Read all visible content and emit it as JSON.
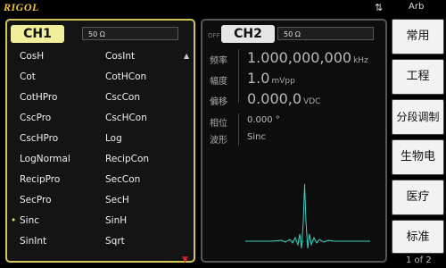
{
  "topbar": {
    "brand": "RIGOL",
    "usb_icon": "usb-icon",
    "mode": "Arb"
  },
  "ch1": {
    "badge": "CH1",
    "state": "OFF",
    "impedance": "50 Ω",
    "list_left": [
      "CosH",
      "Cot",
      "CotHPro",
      "CscPro",
      "CscHPro",
      "LogNormal",
      "RecipPro",
      "SecPro",
      "Sinc",
      "SinInt"
    ],
    "list_right": [
      "CosInt",
      "CotHCon",
      "CscCon",
      "CscHCon",
      "Log",
      "RecipCon",
      "SecCon",
      "SecH",
      "SinH",
      "Sqrt"
    ],
    "selected": "Sinc"
  },
  "ch2": {
    "badge": "CH2",
    "state": "OFF",
    "impedance": "50 Ω",
    "freq_label": "频率",
    "freq_value": "1.000,000,000",
    "freq_unit": "kHz",
    "amp_label": "幅度",
    "amp_value": "1.0",
    "amp_unit": "mVpp",
    "offset_label": "偏移",
    "offset_value": "0.000,0",
    "offset_unit": "VDC",
    "phase_label": "相位",
    "phase_value": "0.000 °",
    "wave_label": "波形",
    "wave_value": "Sinc"
  },
  "menu": {
    "items": [
      "常用",
      "工程",
      "分段调制",
      "生物电",
      "医疗",
      "标准"
    ],
    "page": "1 of 2"
  },
  "colors": {
    "brand": "#f1c34a",
    "ch1_accent": "#f0ee9a",
    "trace": "#3fd0c0"
  }
}
